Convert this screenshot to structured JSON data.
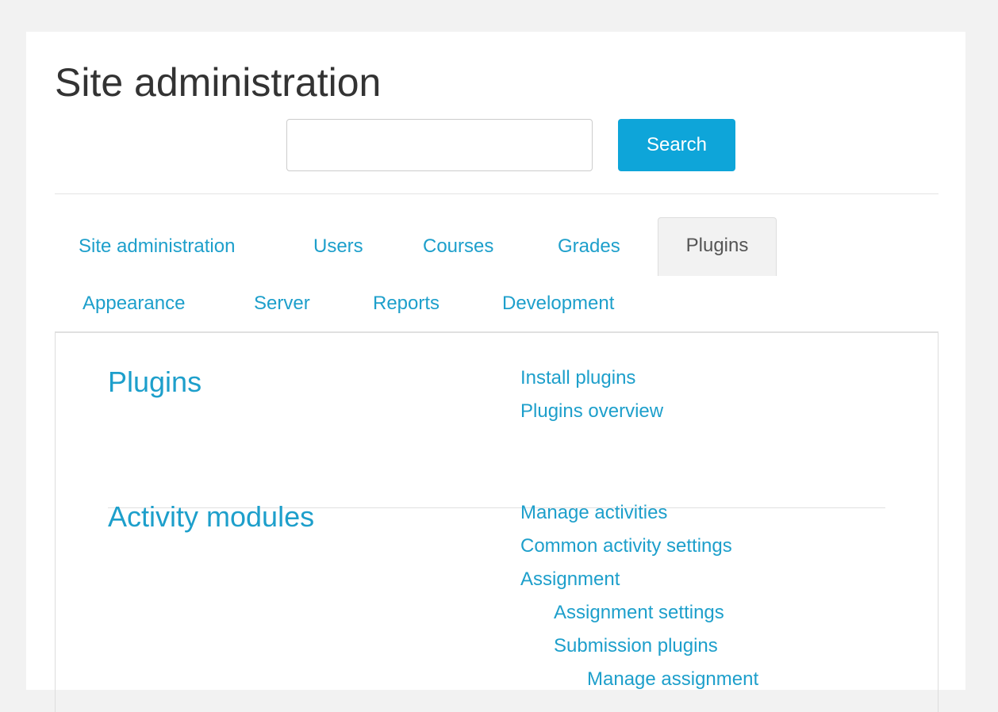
{
  "header": {
    "title": "Site administration"
  },
  "search": {
    "value": "",
    "placeholder": "",
    "button_label": "Search"
  },
  "tabs": [
    {
      "label": "Site administration",
      "active": false
    },
    {
      "label": "Users",
      "active": false
    },
    {
      "label": "Courses",
      "active": false
    },
    {
      "label": "Grades",
      "active": false
    },
    {
      "label": "Plugins",
      "active": true
    },
    {
      "label": "Appearance",
      "active": false
    },
    {
      "label": "Server",
      "active": false
    },
    {
      "label": "Reports",
      "active": false
    },
    {
      "label": "Development",
      "active": false
    }
  ],
  "sections": [
    {
      "heading": "Plugins",
      "links": [
        {
          "label": "Install plugins"
        },
        {
          "label": "Plugins overview"
        }
      ]
    },
    {
      "heading": "Activity modules",
      "links": [
        {
          "label": "Manage activities"
        },
        {
          "label": "Common activity settings"
        },
        {
          "label": "Assignment"
        },
        {
          "label": "Assignment settings"
        },
        {
          "label": "Submission plugins"
        },
        {
          "label": "Manage assignment"
        }
      ]
    }
  ],
  "colors": {
    "link": "#1d9fcb",
    "button": "#0ea5d9",
    "page_background": "#f2f2f2",
    "active_tab_background": "#f2f2f2"
  }
}
